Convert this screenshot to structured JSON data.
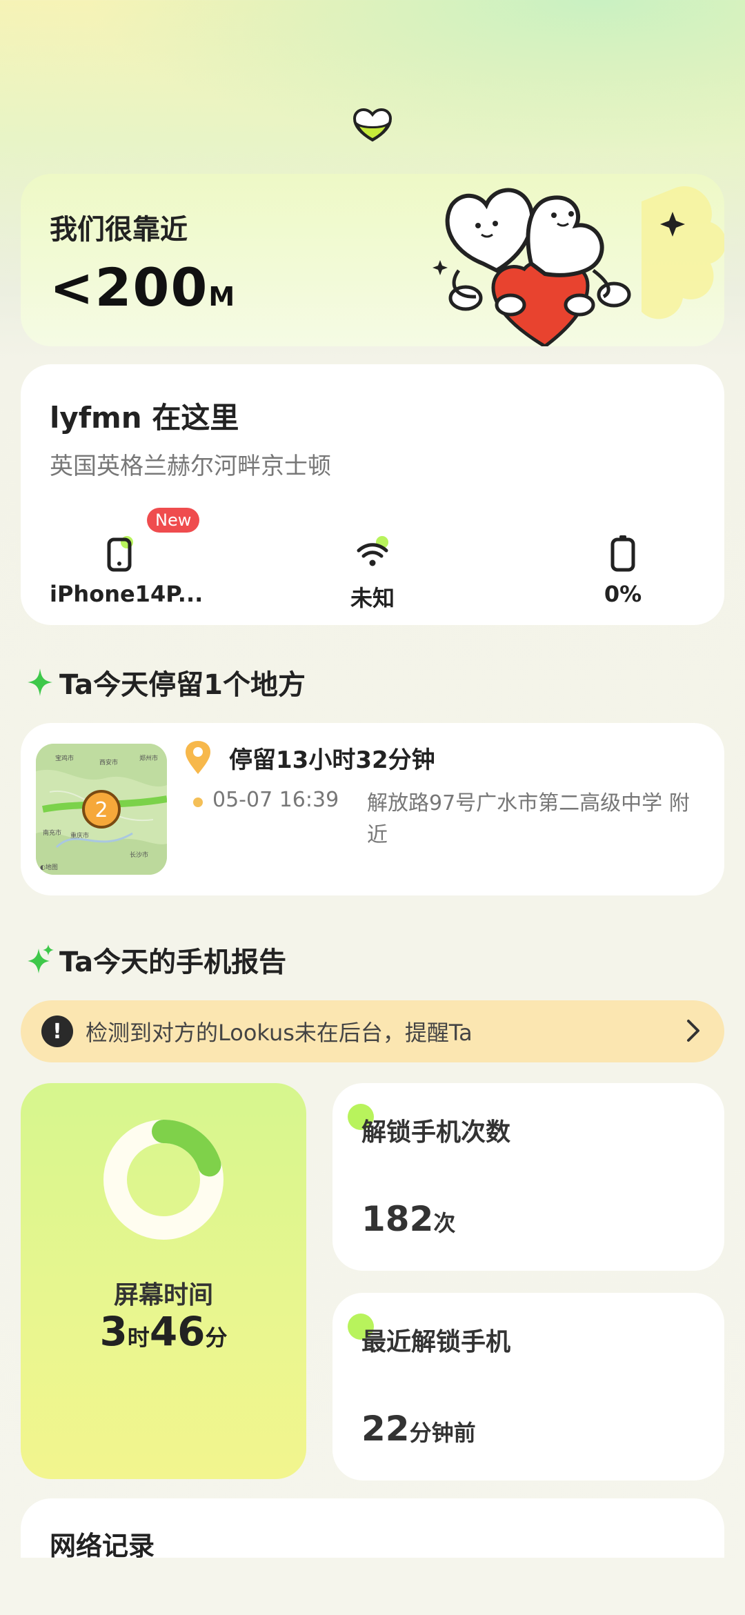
{
  "distance": {
    "title": "我们很靠近",
    "value": "<200",
    "unit": "M"
  },
  "location": {
    "title": "lyfmn 在这里",
    "address": "英国英格兰赫尔河畔京士顿",
    "stats": {
      "device": "iPhone14P...",
      "device_badge": "New",
      "wifi": "未知",
      "battery": "0%"
    }
  },
  "stay_section": {
    "title": "Ta今天停留1个地方"
  },
  "stay": {
    "map_badge": "2",
    "map_labels": [
      "宝鸡市",
      "西安市",
      "郑州市",
      "南充市",
      "重庆市",
      "长沙市",
      "◐地图"
    ],
    "duration": "停留13小时32分钟",
    "time": "05-07 16:39",
    "place": "解放路97号广水市第二高级中学 附近"
  },
  "report_section": {
    "title": "Ta今天的手机报告"
  },
  "reminder": {
    "text": "检测到对方的Lookus未在后台，提醒Ta"
  },
  "screen_time": {
    "label": "屏幕时间",
    "hours": "3",
    "hours_unit": "时",
    "minutes": "46",
    "minutes_unit": "分",
    "progress": 0.2
  },
  "unlock_count": {
    "title": "解锁手机次数",
    "value": "182",
    "unit": "次"
  },
  "last_unlock": {
    "title": "最近解锁手机",
    "value": "22",
    "unit": "分钟前"
  },
  "network": {
    "title": "网络记录"
  },
  "colors": {
    "accent_green": "#b8f35c",
    "ring_green": "#7fd14a",
    "badge_red": "#ef4c4e",
    "pin_orange": "#f7b84b",
    "banner": "#fbe6b1"
  }
}
